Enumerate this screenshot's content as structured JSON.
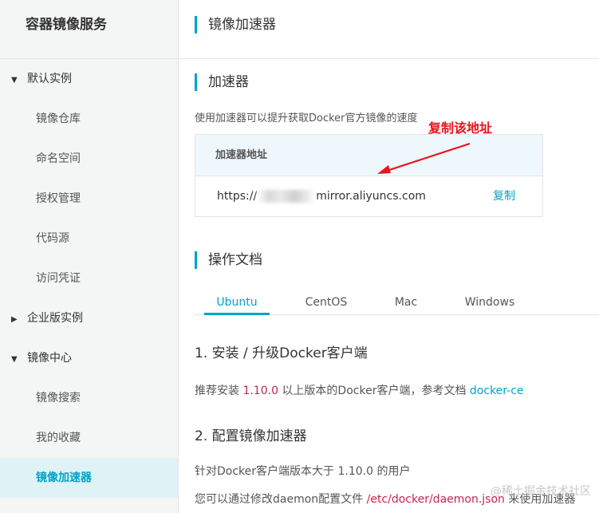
{
  "sidebar": {
    "title": "容器镜像服务",
    "items": [
      {
        "type": "group",
        "label": "默认实例",
        "caret": "▼"
      },
      {
        "type": "item",
        "label": "镜像仓库"
      },
      {
        "type": "item",
        "label": "命名空间"
      },
      {
        "type": "item",
        "label": "授权管理"
      },
      {
        "type": "item",
        "label": "代码源"
      },
      {
        "type": "item",
        "label": "访问凭证"
      },
      {
        "type": "group",
        "label": "企业版实例",
        "caret": "▶"
      },
      {
        "type": "group",
        "label": "镜像中心",
        "caret": "▼"
      },
      {
        "type": "item",
        "label": "镜像搜索"
      },
      {
        "type": "item",
        "label": "我的收藏"
      },
      {
        "type": "item",
        "label": "镜像加速器",
        "active": true
      }
    ]
  },
  "header": {
    "title": "镜像加速器"
  },
  "accelerator": {
    "section_title": "加速器",
    "description": "使用加速器可以提升获取Docker官方镜像的速度",
    "box_header": "加速器地址",
    "url_prefix": "https://",
    "url_suffix": "mirror.aliyuncs.com",
    "copy_label": "复制"
  },
  "annotation": {
    "label": "复制该地址",
    "color": "#e8151c"
  },
  "docs": {
    "section_title": "操作文档",
    "tabs": [
      "Ubuntu",
      "CentOS",
      "Mac",
      "Windows"
    ],
    "active_tab": "Ubuntu",
    "step1_title": "1. 安装 / 升级Docker客户端",
    "step1_text_before": "推荐安装",
    "step1_version": "1.10.0",
    "step1_text_after": "以上版本的Docker客户端，参考文档",
    "step1_link": "docker-ce",
    "step2_title": "2. 配置镜像加速器",
    "step2_text1_before": "针对Docker客户端版本大于",
    "step2_version": "1.10.0",
    "step2_text1_after": "的用户",
    "step2_text2_before": "您可以通过修改daemon配置文件",
    "step2_path": "/etc/docker/daemon.json",
    "step2_text2_after": "来使用加速器"
  },
  "watermark": "@稀土掘金技术社区",
  "colors": {
    "accent": "#00a2ca",
    "highlight": "#c7254e",
    "active_bg": "#dff2f6"
  }
}
